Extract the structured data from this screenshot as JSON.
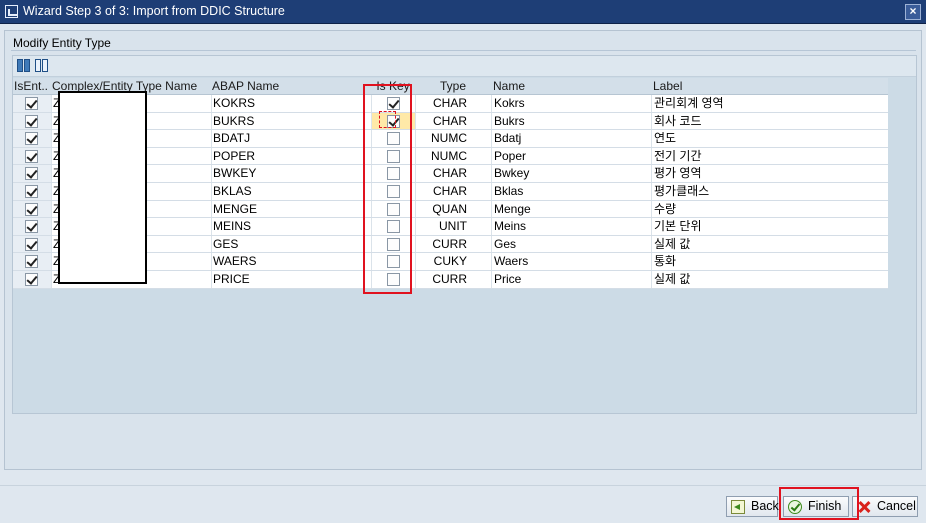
{
  "window": {
    "title": "Wizard Step 3 of 3: Import from DDIC Structure",
    "close_icon": "close-icon"
  },
  "group": {
    "title": "Modify Entity Type"
  },
  "toolbar": {
    "icons": [
      "select-all-icon",
      "deselect-all-icon"
    ]
  },
  "table": {
    "headers": {
      "is_entity": "IsEnt..",
      "complex": "Complex/Entity Type Name",
      "abap": "ABAP Name",
      "is_key": "Is Key",
      "type": "Type",
      "name": "Name",
      "label": "Label"
    },
    "rows": [
      {
        "is_entity": true,
        "complex": "Z",
        "abap": "KOKRS",
        "is_key": true,
        "type": "CHAR",
        "name": "Kokrs",
        "label": "관리회계 영역"
      },
      {
        "is_entity": true,
        "complex": "Z",
        "abap": "BUKRS",
        "is_key": true,
        "type": "CHAR",
        "name": "Bukrs",
        "label": "회사 코드"
      },
      {
        "is_entity": true,
        "complex": "Z",
        "abap": "BDATJ",
        "is_key": false,
        "type": "NUMC",
        "name": "Bdatj",
        "label": "연도"
      },
      {
        "is_entity": true,
        "complex": "Z",
        "abap": "POPER",
        "is_key": false,
        "type": "NUMC",
        "name": "Poper",
        "label": "전기 기간"
      },
      {
        "is_entity": true,
        "complex": "Z",
        "abap": "BWKEY",
        "is_key": false,
        "type": "CHAR",
        "name": "Bwkey",
        "label": "평가 영역"
      },
      {
        "is_entity": true,
        "complex": "Z",
        "abap": "BKLAS",
        "is_key": false,
        "type": "CHAR",
        "name": "Bklas",
        "label": "평가클래스"
      },
      {
        "is_entity": true,
        "complex": "Z",
        "abap": "MENGE",
        "is_key": false,
        "type": "QUAN",
        "name": "Menge",
        "label": "수량"
      },
      {
        "is_entity": true,
        "complex": "Z",
        "abap": "MEINS",
        "is_key": false,
        "type": "UNIT",
        "name": "Meins",
        "label": "기본 단위"
      },
      {
        "is_entity": true,
        "complex": "Z",
        "abap": "GES",
        "is_key": false,
        "type": "CURR",
        "name": "Ges",
        "label": "실제 값"
      },
      {
        "is_entity": true,
        "complex": "Z",
        "abap": "WAERS",
        "is_key": false,
        "type": "CUKY",
        "name": "Waers",
        "label": "통화"
      },
      {
        "is_entity": true,
        "complex": "Z",
        "abap": "PRICE",
        "is_key": false,
        "type": "CURR",
        "name": "Price",
        "label": "실제 값"
      }
    ]
  },
  "buttons": {
    "back": "Back",
    "finish": "Finish",
    "cancel": "Cancel"
  },
  "colors": {
    "titlebar": "#1e3e76",
    "highlight": "#e0121f",
    "focus_cell": "#ffe9a8"
  }
}
